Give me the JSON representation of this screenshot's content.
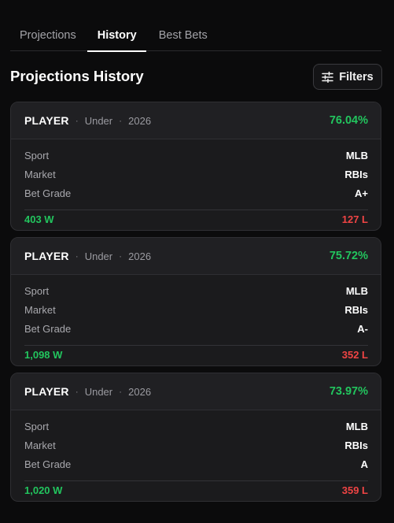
{
  "tabs": [
    {
      "label": "Projections",
      "active": false
    },
    {
      "label": "History",
      "active": true
    },
    {
      "label": "Best Bets",
      "active": false
    }
  ],
  "page_title": "Projections History",
  "filters_label": "Filters",
  "separator": "·",
  "colors": {
    "win": "#22c55e",
    "loss": "#ef4444",
    "background": "#0b0b0c",
    "card": "#1b1b1d"
  },
  "cards": [
    {
      "player": "PLAYER",
      "direction": "Under",
      "year": "2026",
      "percent": "76.04%",
      "rows": [
        {
          "label": "Sport",
          "value": "MLB"
        },
        {
          "label": "Market",
          "value": "RBIs"
        },
        {
          "label": "Bet Grade",
          "value": "A+"
        }
      ],
      "wins": "403 W",
      "losses": "127 L"
    },
    {
      "player": "PLAYER",
      "direction": "Under",
      "year": "2026",
      "percent": "75.72%",
      "rows": [
        {
          "label": "Sport",
          "value": "MLB"
        },
        {
          "label": "Market",
          "value": "RBIs"
        },
        {
          "label": "Bet Grade",
          "value": "A-"
        }
      ],
      "wins": "1,098 W",
      "losses": "352 L"
    },
    {
      "player": "PLAYER",
      "direction": "Under",
      "year": "2026",
      "percent": "73.97%",
      "rows": [
        {
          "label": "Sport",
          "value": "MLB"
        },
        {
          "label": "Market",
          "value": "RBIs"
        },
        {
          "label": "Bet Grade",
          "value": "A"
        }
      ],
      "wins": "1,020 W",
      "losses": "359 L"
    }
  ]
}
